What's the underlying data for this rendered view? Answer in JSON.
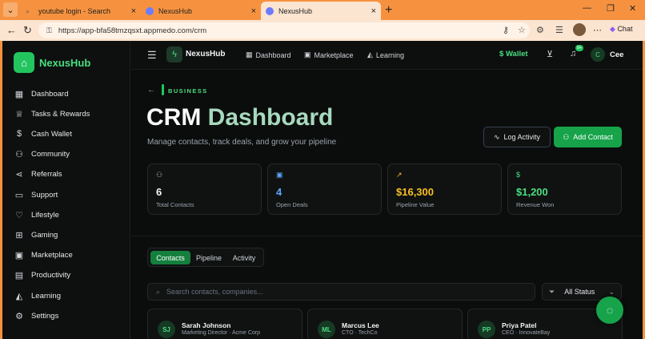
{
  "browser": {
    "tabs": [
      {
        "title": "youtube login - Search"
      },
      {
        "title": "NexusHub"
      },
      {
        "title": "NexusHub"
      }
    ],
    "url": "https://app-bfa58tmzqsxt.appmedo.com/crm",
    "chat_label": "Chat"
  },
  "sidebar": {
    "brand": "NexusHub",
    "items": [
      {
        "label": "Dashboard",
        "icon": "grid-icon"
      },
      {
        "label": "Tasks & Rewards",
        "icon": "trophy-icon"
      },
      {
        "label": "Cash Wallet",
        "icon": "dollar-icon"
      },
      {
        "label": "Community",
        "icon": "users-icon"
      },
      {
        "label": "Referrals",
        "icon": "share-icon"
      },
      {
        "label": "Support",
        "icon": "message-icon"
      },
      {
        "label": "Lifestyle",
        "icon": "heart-icon"
      },
      {
        "label": "Gaming",
        "icon": "gamepad-icon"
      },
      {
        "label": "Marketplace",
        "icon": "bag-icon"
      },
      {
        "label": "Productivity",
        "icon": "briefcase-icon"
      },
      {
        "label": "Learning",
        "icon": "graduation-icon"
      },
      {
        "label": "Settings",
        "icon": "gear-icon"
      }
    ]
  },
  "topbar": {
    "brand": "NexusHub",
    "nav": [
      {
        "label": "Dashboard"
      },
      {
        "label": "Marketplace"
      },
      {
        "label": "Learning"
      }
    ],
    "wallet": "Wallet",
    "badge": "9+",
    "user_initial": "C",
    "user_name": "Cee"
  },
  "header": {
    "crumb": "BUSINESS",
    "title_a": "CRM ",
    "title_b": "Dashboard",
    "subtitle": "Manage contacts, track deals, and grow your pipeline",
    "log_activity": "Log Activity",
    "add_contact": "Add Contact"
  },
  "stats": [
    {
      "value": "6",
      "label": "Total Contacts",
      "color": "#f3f4f6",
      "icon_color": "#9ca3af"
    },
    {
      "value": "4",
      "label": "Open Deals",
      "color": "#60a5fa",
      "icon_color": "#60a5fa"
    },
    {
      "value": "$16,300",
      "label": "Pipeline Value",
      "color": "#fbbf24",
      "icon_color": "#fbbf24"
    },
    {
      "value": "$1,200",
      "label": "Revenue Won",
      "color": "#4ade80",
      "icon_color": "#4ade80"
    }
  ],
  "tabs": [
    "Contacts",
    "Pipeline",
    "Activity"
  ],
  "search": {
    "placeholder": "Search contacts, companies..."
  },
  "filter": {
    "value": "All Status"
  },
  "contacts": [
    {
      "initials": "SJ",
      "name": "Sarah Johnson",
      "role": "Marketing Director · Acme Corp"
    },
    {
      "initials": "ML",
      "name": "Marcus Lee",
      "role": "CTO · TechCo"
    },
    {
      "initials": "PP",
      "name": "Priya Patel",
      "role": "CEO · InnovateBay"
    }
  ]
}
